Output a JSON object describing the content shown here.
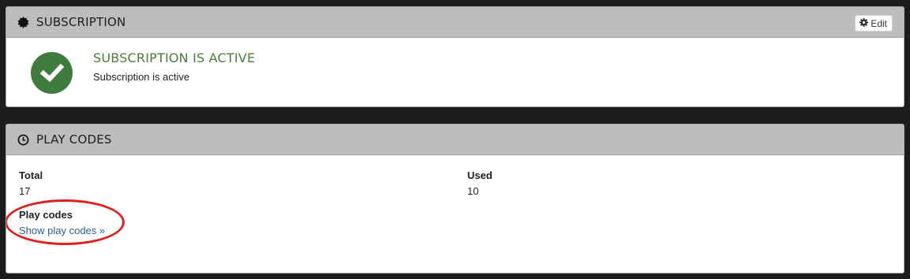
{
  "subscription_panel": {
    "title": "SUBSCRIPTION",
    "title_icon": "certificate-icon",
    "edit_label": "Edit",
    "status_icon": "check-circle-icon",
    "status_title": "SUBSCRIPTION IS ACTIVE",
    "status_text": "Subscription is active",
    "status_color": "#3f7a3f"
  },
  "play_codes_panel": {
    "title": "PLAY CODES",
    "title_icon": "clock-icon",
    "total_label": "Total",
    "total_value": "17",
    "used_label": "Used",
    "used_value": "10",
    "codes_label": "Play codes",
    "show_link": "Show play codes »",
    "highlight_color": "#e0201f"
  },
  "colors": {
    "page_bg": "#1c1c1c",
    "header_bg": "#bdbdbd",
    "link": "#2e5f8a"
  }
}
